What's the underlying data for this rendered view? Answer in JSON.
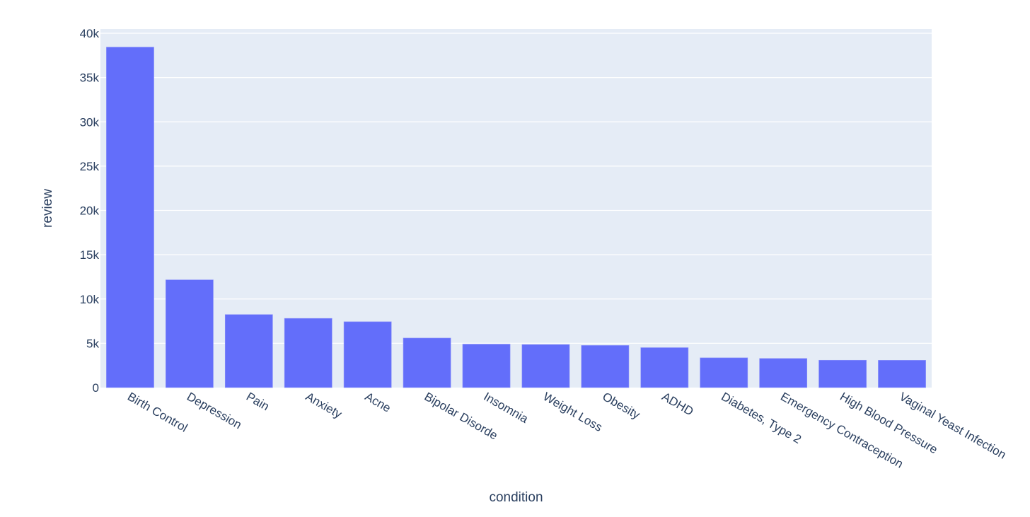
{
  "chart_data": {
    "type": "bar",
    "title": "",
    "xlabel": "condition",
    "ylabel": "review",
    "categories": [
      "Birth Control",
      "Depression",
      "Pain",
      "Anxiety",
      "Acne",
      "Bipolar Disorde",
      "Insomnia",
      "Weight Loss",
      "Obesity",
      "ADHD",
      "Diabetes, Type 2",
      "Emergency Contraception",
      "High Blood Pressure",
      "Vaginal Yeast Infection"
    ],
    "values": [
      38436,
      12164,
      8245,
      7812,
      7435,
      5592,
      4904,
      4857,
      4757,
      4509,
      3362,
      3285,
      3091,
      3085
    ],
    "ylim": [
      0,
      40480
    ],
    "yticks": [
      0,
      5000,
      10000,
      15000,
      20000,
      25000,
      30000,
      35000,
      40000
    ],
    "ytick_labels": [
      "0",
      "5k",
      "10k",
      "15k",
      "20k",
      "25k",
      "30k",
      "35k",
      "40k"
    ],
    "grid": true,
    "legend": "none",
    "colors": {
      "bar": "#636efa",
      "plot_bg": "#e5ecf6",
      "grid": "#ffffff",
      "text": "#2a3f5f"
    }
  }
}
